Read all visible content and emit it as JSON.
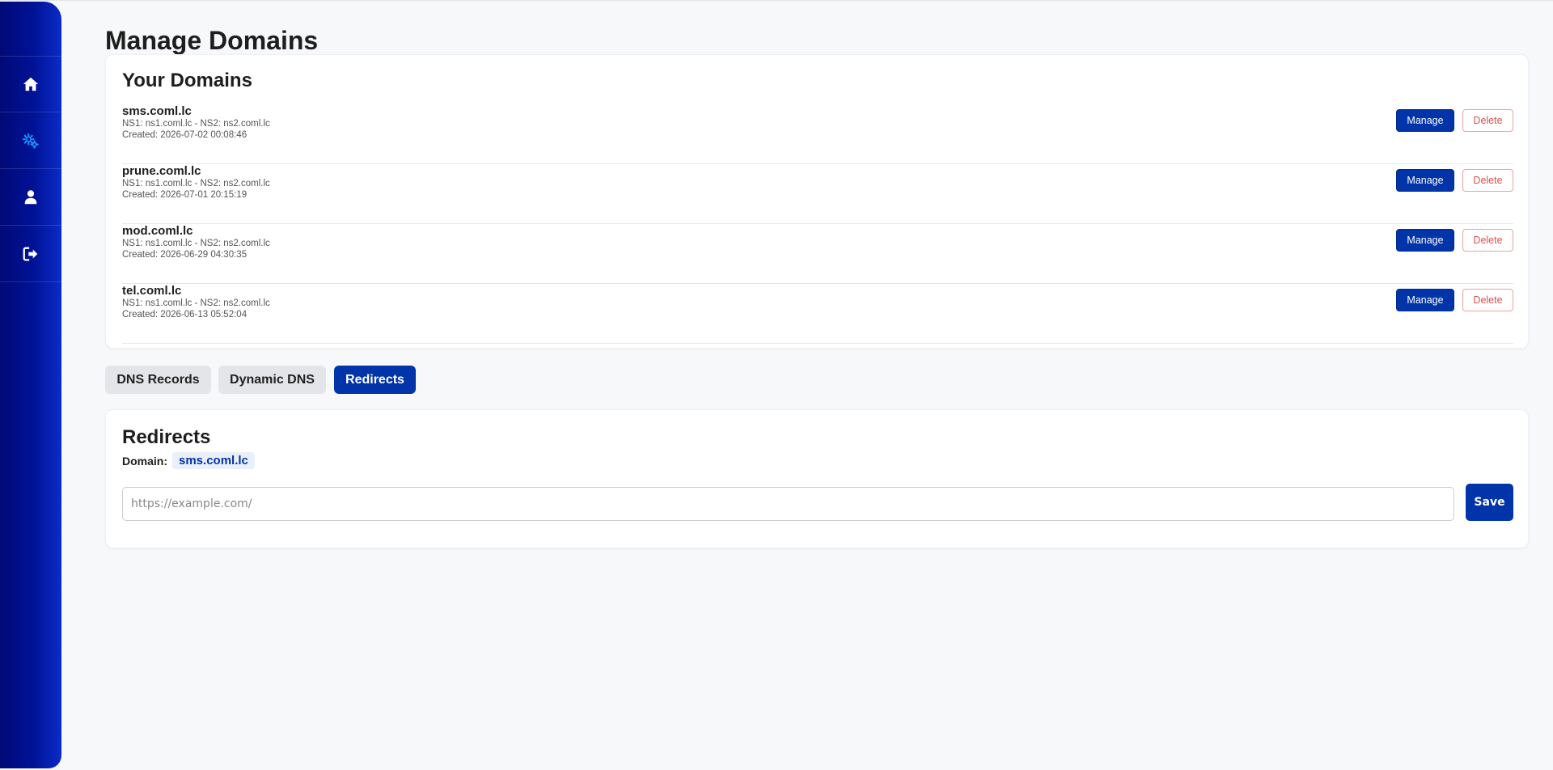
{
  "sidebar": {
    "items": [
      {
        "icon": "home-icon",
        "active": false
      },
      {
        "icon": "gears-icon",
        "active": true
      },
      {
        "icon": "user-icon",
        "active": false
      },
      {
        "icon": "sign-out-icon",
        "active": false
      }
    ]
  },
  "page": {
    "title": "Manage Domains"
  },
  "domains": {
    "title": "Your Domains",
    "manage_label": "Manage",
    "delete_label": "Delete",
    "items": [
      {
        "name": "sms.coml.lc",
        "ns": "NS1: ns1.coml.lc - NS2: ns2.coml.lc",
        "created": "Created: 2026-07-02 00:08:46"
      },
      {
        "name": "prune.coml.lc",
        "ns": "NS1: ns1.coml.lc - NS2: ns2.coml.lc",
        "created": "Created: 2026-07-01 20:15:19"
      },
      {
        "name": "mod.coml.lc",
        "ns": "NS1: ns1.coml.lc - NS2: ns2.coml.lc",
        "created": "Created: 2026-06-29 04:30:35"
      },
      {
        "name": "tel.coml.lc",
        "ns": "NS1: ns1.coml.lc - NS2: ns2.coml.lc",
        "created": "Created: 2026-06-13 05:52:04"
      }
    ]
  },
  "tabs": [
    {
      "label": "DNS Records",
      "active": false
    },
    {
      "label": "Dynamic DNS",
      "active": false
    },
    {
      "label": "Redirects",
      "active": true
    }
  ],
  "redirects": {
    "title": "Redirects",
    "domain_label": "Domain:",
    "domain_value": "sms.coml.lc",
    "input_value": "",
    "input_placeholder": "https://example.com/",
    "save_label": "Save"
  },
  "colors": {
    "primary": "#0034a8",
    "danger": "#d9534f",
    "sidebar_dark": "#000a78",
    "sidebar_light": "#0a2cc8",
    "active_icon": "#1e90ff",
    "background": "#f7f8fa"
  }
}
